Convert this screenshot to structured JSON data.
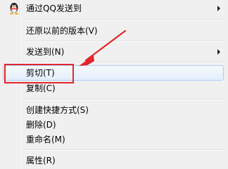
{
  "menu": {
    "items": [
      {
        "label": "通过QQ发送到",
        "has_submenu": true,
        "icon": "qq-penguin-icon"
      },
      {
        "label": "还原以前的版本(V)",
        "has_submenu": false
      },
      {
        "label": "发送到(N)",
        "has_submenu": true
      },
      {
        "label": "剪切(T)",
        "has_submenu": false,
        "highlighted": true
      },
      {
        "label": "复制(C)",
        "has_submenu": false
      },
      {
        "label": "创建快捷方式(S)",
        "has_submenu": false
      },
      {
        "label": "删除(D)",
        "has_submenu": false
      },
      {
        "label": "重命名(M)",
        "has_submenu": false
      },
      {
        "label": "属性(R)",
        "has_submenu": false
      }
    ]
  },
  "annotation": {
    "color": "#e3262b",
    "target": "剪切(T)"
  },
  "colors": {
    "menu_background": "#f0f0f0",
    "hover_background": "#e4eefb",
    "hover_border": "#aecff7",
    "annotation_red": "#e3262b"
  }
}
